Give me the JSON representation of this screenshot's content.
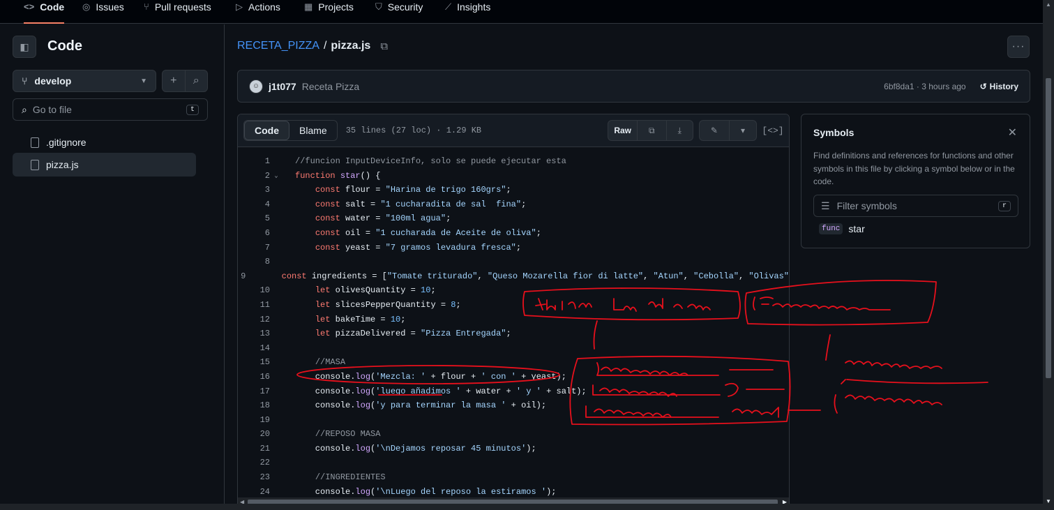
{
  "nav": {
    "tabs": [
      {
        "label": "Code",
        "icon": "code-icon"
      },
      {
        "label": "Issues",
        "icon": "issue-icon"
      },
      {
        "label": "Pull requests",
        "icon": "pull-request-icon"
      },
      {
        "label": "Actions",
        "icon": "play-icon"
      },
      {
        "label": "Projects",
        "icon": "table-icon"
      },
      {
        "label": "Security",
        "icon": "shield-icon"
      },
      {
        "label": "Insights",
        "icon": "graph-icon"
      }
    ]
  },
  "sidebar": {
    "title": "Code",
    "branch": "develop",
    "go_to_file_placeholder": "Go to file",
    "go_to_file_key": "t",
    "files": [
      ".gitignore",
      "pizza.js"
    ],
    "selected_file": "pizza.js"
  },
  "breadcrumb": {
    "repo": "RECETA_PIZZA",
    "separator": "/",
    "file": "pizza.js"
  },
  "commit": {
    "author": "j1t077",
    "message": "Receta Pizza",
    "sha_time": "6bf8da1 · 3 hours ago",
    "history_label": "History"
  },
  "code_view": {
    "tab_code": "Code",
    "tab_blame": "Blame",
    "meta": "35 lines (27 loc) · 1.29 KB",
    "raw_label": "Raw"
  },
  "code_lines": [
    {
      "n": "1",
      "html": "<span class='c'>//funcion InputDeviceInfo, solo se puede ejecutar esta</span>"
    },
    {
      "n": "2",
      "fold": true,
      "html": "<span class='k'>function</span> <span class='f'>star</span>() {"
    },
    {
      "n": "3",
      "html": "    <span class='k'>const</span> flour = <span class='s'>\"Harina de trigo 160grs\"</span>;"
    },
    {
      "n": "4",
      "html": "    <span class='k'>const</span> salt = <span class='s'>\"1 cucharadita de sal  fina\"</span>;"
    },
    {
      "n": "5",
      "html": "    <span class='k'>const</span> water = <span class='s'>\"100ml agua\"</span>;"
    },
    {
      "n": "6",
      "html": "    <span class='k'>const</span> oil = <span class='s'>\"1 cucharada de Aceite de oliva\"</span>;"
    },
    {
      "n": "7",
      "html": "    <span class='k'>const</span> yeast = <span class='s'>\"7 gramos levadura fresca\"</span>;"
    },
    {
      "n": "8",
      "html": ""
    },
    {
      "n": "9",
      "html": "    <span class='k'>const</span> ingredients = [<span class='s'>\"Tomate triturado\"</span>, <span class='s'>\"Queso Mozarella fior di latte\"</span>, <span class='s'>\"Atun\"</span>, <span class='s'>\"Cebolla\"</span>, <span class='s'>\"Olivas\"</span>"
    },
    {
      "n": "10",
      "html": "    <span class='k'>let</span> olivesQuantity = <span class='n'>10</span>;"
    },
    {
      "n": "11",
      "html": "    <span class='k'>let</span> slicesPepperQuantity = <span class='n'>8</span>;"
    },
    {
      "n": "12",
      "html": "    <span class='k'>let</span> bakeTime = <span class='n'>10</span>;"
    },
    {
      "n": "13",
      "html": "    <span class='k'>let</span> pizzaDelivered = <span class='s'>\"Pizza Entregada\"</span>;"
    },
    {
      "n": "14",
      "html": ""
    },
    {
      "n": "15",
      "html": "    <span class='c'>//MASA</span>"
    },
    {
      "n": "16",
      "html": "    console.<span class='f'>log</span>(<span class='s'>'Mezcla: '</span> + flour + <span class='s'>' con '</span> + yeast);"
    },
    {
      "n": "17",
      "html": "    console.<span class='f'>log</span>(<span class='s'>'luego añadimos '</span> + water + <span class='s'>' y '</span> + salt);"
    },
    {
      "n": "18",
      "html": "    console.<span class='f'>log</span>(<span class='s'>'y para terminar la masa '</span> + oil);"
    },
    {
      "n": "19",
      "html": ""
    },
    {
      "n": "20",
      "html": "    <span class='c'>//REPOSO MASA</span>"
    },
    {
      "n": "21",
      "html": "    console.<span class='f'>log</span>(<span class='s'>'\\nDejamos reposar 45 minutos'</span>);"
    },
    {
      "n": "22",
      "html": ""
    },
    {
      "n": "23",
      "html": "    <span class='c'>//INGREDIENTES</span>"
    },
    {
      "n": "24",
      "html": "    console.<span class='f'>log</span>(<span class='s'>'\\nLuego del reposo la estiramos '</span>);"
    }
  ],
  "symbols": {
    "title": "Symbols",
    "description": "Find definitions and references for functions and other symbols in this file by clicking a symbol below or in the code.",
    "filter_placeholder": "Filter symbols",
    "filter_key": "r",
    "items": [
      {
        "kind": "func",
        "name": "star"
      }
    ]
  },
  "colors": {
    "accent": "#4493f8",
    "ink": "#e8101c",
    "tab_underline": "#f78166"
  }
}
